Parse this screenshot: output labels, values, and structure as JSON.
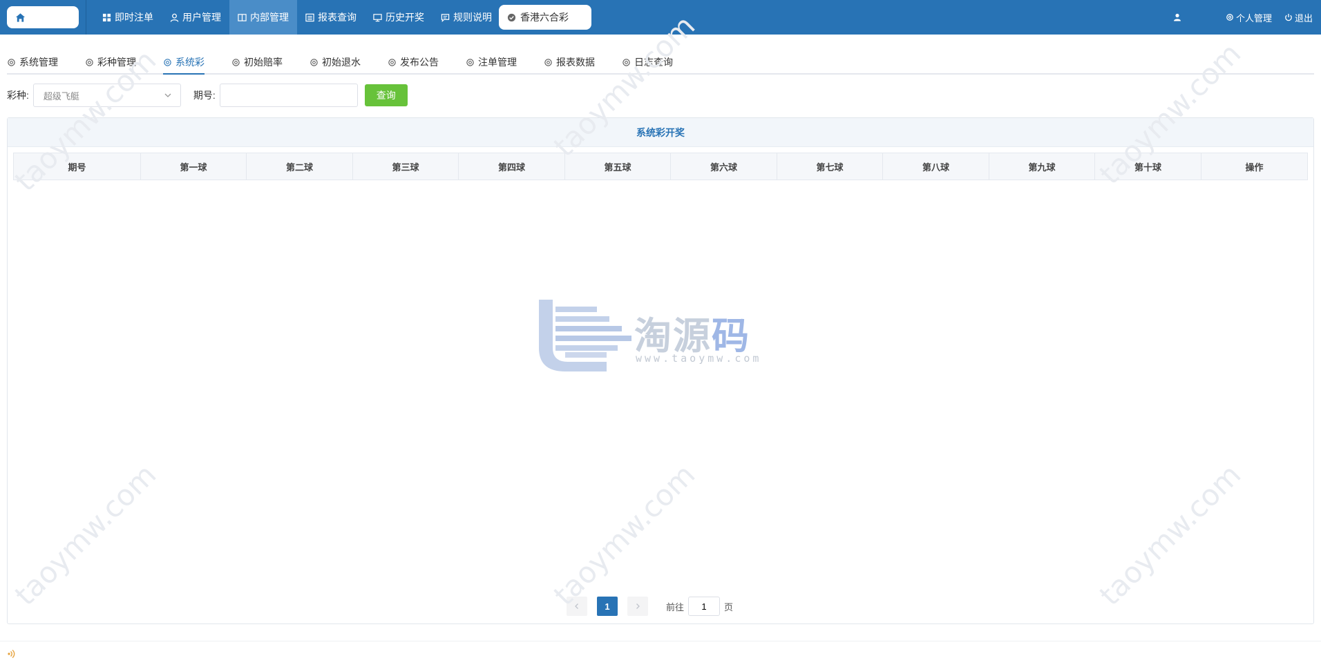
{
  "topbar": {
    "nav": [
      {
        "icon": "grid-icon",
        "label": "即时注单"
      },
      {
        "icon": "user-icon",
        "label": "用户管理"
      },
      {
        "icon": "book-icon",
        "label": "内部管理"
      },
      {
        "icon": "list-icon",
        "label": "报表查询"
      },
      {
        "icon": "monitor-icon",
        "label": "历史开奖"
      },
      {
        "icon": "chat-icon",
        "label": "规则说明"
      }
    ],
    "active_nav": "内部管理",
    "lottery_tab": "香港六合彩",
    "personal_label": "个人管理",
    "logout_label": "退出"
  },
  "subtabs": {
    "items": [
      "系统管理",
      "彩种管理",
      "系统彩",
      "初始赔率",
      "初始退水",
      "发布公告",
      "注单管理",
      "报表数据",
      "日志查询"
    ],
    "active": "系统彩"
  },
  "filters": {
    "lottery_label": "彩种:",
    "lottery_value": "超级飞艇",
    "issue_label": "期号:",
    "issue_value": "",
    "query_label": "查询"
  },
  "panel": {
    "title": "系统彩开奖",
    "columns": [
      "期号",
      "第一球",
      "第二球",
      "第三球",
      "第四球",
      "第五球",
      "第六球",
      "第七球",
      "第八球",
      "第九球",
      "第十球",
      "操作"
    ],
    "rows": []
  },
  "pagination": {
    "current_page": "1",
    "goto_label": "前往",
    "goto_value": "1",
    "page_suffix": "页"
  },
  "watermark": {
    "name_part1": "淘源",
    "name_part2": "码",
    "url": "www.taoymw.com",
    "diagonal_text": "taoymw.com"
  },
  "colors": {
    "topbar": "#2873b5",
    "accent": "#2873b5",
    "query_button": "#67c23a"
  }
}
